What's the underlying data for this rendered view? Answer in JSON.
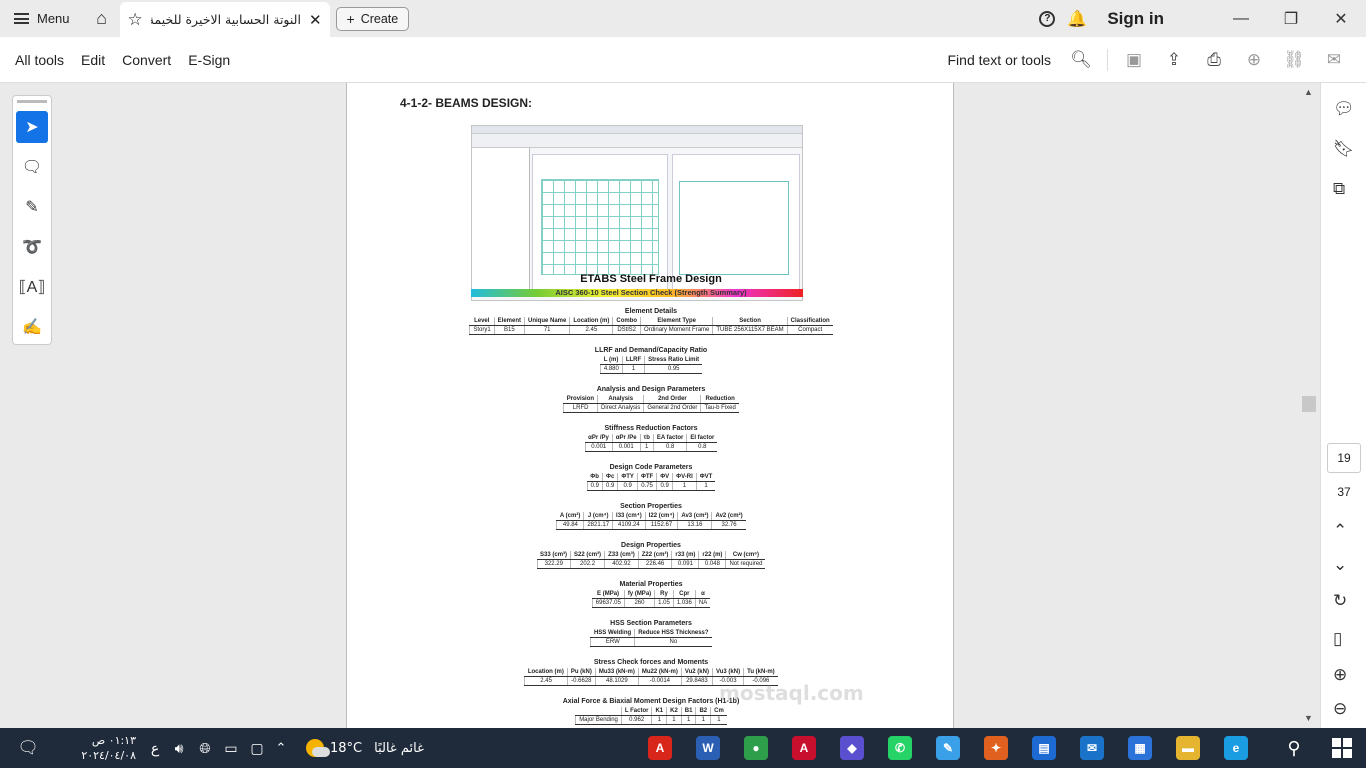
{
  "tabbar": {
    "menu_label": "Menu",
    "doc_title": "النوتة الحسابية الاخيرة للخيمة...",
    "create_label": "Create",
    "help_icon": "?",
    "signin_label": "Sign in"
  },
  "toolbar": {
    "menus": [
      "All tools",
      "Edit",
      "Convert",
      "E-Sign"
    ],
    "find_label": "Find text or tools"
  },
  "document": {
    "heading": "4-1-2- BEAMS DESIGN:",
    "frame_design_title": "ETABS Steel Frame Design",
    "frame_design_subtitle": "AISC 360-10 Steel Section Check (Strength Summary)",
    "sections": [
      {
        "title": "Element Details",
        "headers": [
          "Level",
          "Element",
          "Unique Name",
          "Location (m)",
          "Combo",
          "Element Type",
          "Section",
          "Classification"
        ],
        "row": [
          "Story1",
          "B15",
          "71",
          "2.45",
          "DStlS2",
          "Ordinary Moment Frame",
          "TUBE 256X115X7 BEAM",
          "Compact"
        ]
      },
      {
        "title": "LLRF and Demand/Capacity Ratio",
        "headers": [
          "L (m)",
          "LLRF",
          "Stress Ratio Limit"
        ],
        "row": [
          "4.880",
          "1",
          "0.95"
        ]
      },
      {
        "title": "Analysis and Design Parameters",
        "headers": [
          "Provision",
          "Analysis",
          "2nd Order",
          "Reduction"
        ],
        "row": [
          "LRFD",
          "Direct Analysis",
          "General 2nd Order",
          "Tau-b Fixed"
        ]
      },
      {
        "title": "Stiffness Reduction Factors",
        "headers": [
          "αPr /Py",
          "αPr /Pe",
          "τb",
          "EA factor",
          "EI factor"
        ],
        "row": [
          "0.001",
          "0.001",
          "1",
          "0.8",
          "0.8"
        ]
      },
      {
        "title": "Design Code Parameters",
        "headers": [
          "Φb",
          "Φc",
          "ΦTY",
          "ΦTF",
          "ΦV",
          "ΦV-RI",
          "ΦVT"
        ],
        "row": [
          "0.9",
          "0.9",
          "0.9",
          "0.75",
          "0.9",
          "1",
          "1"
        ]
      },
      {
        "title": "Section Properties",
        "headers": [
          "A (cm²)",
          "J (cm⁴)",
          "I33 (cm⁴)",
          "I22 (cm⁴)",
          "Av3 (cm²)",
          "Av2 (cm²)"
        ],
        "row": [
          "49.84",
          "2821.17",
          "4109.24",
          "1152.67",
          "13.16",
          "32.76"
        ]
      },
      {
        "title": "Design Properties",
        "headers": [
          "S33 (cm³)",
          "S22 (cm³)",
          "Z33 (cm³)",
          "Z22 (cm³)",
          "r33 (m)",
          "r22 (m)",
          "Cw (cm⁶)"
        ],
        "row": [
          "322.29",
          "202.2",
          "402.92",
          "226.46",
          "0.091",
          "0.048",
          "Not required"
        ]
      },
      {
        "title": "Material Properties",
        "headers": [
          "E (MPa)",
          "fy (MPa)",
          "Ry",
          "Cpr",
          "α"
        ],
        "row": [
          "69637.05",
          "260",
          "1.05",
          "1.036",
          "NA"
        ]
      },
      {
        "title": "HSS Section Parameters",
        "headers": [
          "HSS Welding",
          "Reduce HSS Thickness?"
        ],
        "row": [
          "ERW",
          "No"
        ]
      },
      {
        "title": "Stress Check forces and Moments",
        "headers": [
          "Location (m)",
          "Pu (kN)",
          "Mu33 (kN-m)",
          "Mu22 (kN-m)",
          "Vu2 (kN)",
          "Vu3 (kN)",
          "Tu (kN-m)"
        ],
        "row": [
          "2.45",
          "-0.6628",
          "48.1029",
          "-0.0014",
          "29.8483",
          "-0.003",
          "-0.096"
        ]
      },
      {
        "title": "Axial Force & Biaxial Moment Design Factors  (H1-1b)",
        "headers": [
          "",
          "L Factor",
          "K1",
          "K2",
          "B1",
          "B2",
          "Cm"
        ],
        "row": [
          "Major Bending",
          "0.962",
          "1",
          "1",
          "1",
          "1",
          "1"
        ]
      }
    ]
  },
  "navigation": {
    "current_page": "19",
    "total_pages": "37"
  },
  "taskbar": {
    "time": "٠١:١٣ ص",
    "date": "٢٠٢٤/٠٤/٠٨",
    "lang": "ع",
    "temperature": "18°C",
    "weather_text": "غائم غالبًا",
    "apps": [
      {
        "name": "acrobat-icon",
        "color": "#d8261b",
        "glyph": "A"
      },
      {
        "name": "word-icon",
        "color": "#2b5fb4",
        "glyph": "W"
      },
      {
        "name": "chrome-icon",
        "color": "#2f9e4a",
        "glyph": "●"
      },
      {
        "name": "autocad-icon",
        "color": "#c8102e",
        "glyph": "A"
      },
      {
        "name": "app-icon",
        "color": "#5a4fcf",
        "glyph": "◆"
      },
      {
        "name": "whatsapp-icon",
        "color": "#25d366",
        "glyph": "✆"
      },
      {
        "name": "paint-icon",
        "color": "#3aa0e8",
        "glyph": "✎"
      },
      {
        "name": "tools-icon",
        "color": "#e06020",
        "glyph": "✦"
      },
      {
        "name": "app-blue-icon",
        "color": "#1e6ad3",
        "glyph": "▤"
      },
      {
        "name": "mail-icon",
        "color": "#1a73c9",
        "glyph": "✉"
      },
      {
        "name": "store-icon",
        "color": "#2b73d9",
        "glyph": "▦"
      },
      {
        "name": "explorer-icon",
        "color": "#e6b52f",
        "glyph": "▬"
      },
      {
        "name": "edge-icon",
        "color": "#1b9de2",
        "glyph": "e"
      }
    ]
  },
  "colors": {
    "accent": "#1473e6",
    "taskbar": "#1f2a3a"
  }
}
